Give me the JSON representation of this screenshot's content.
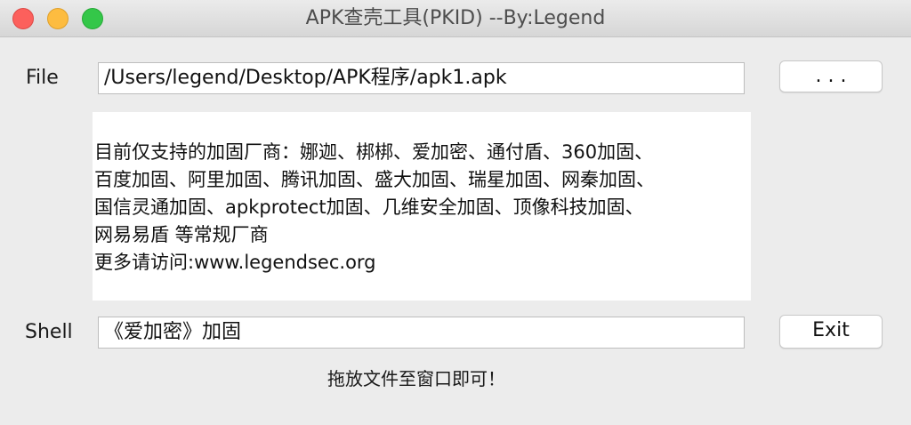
{
  "window": {
    "title": "APK查壳工具(PKID) --By:Legend"
  },
  "file_row": {
    "label": "File",
    "value": "/Users/legend/Desktop/APK程序/apk1.apk",
    "browse_label": ". . ."
  },
  "info": {
    "lines": [
      "目前仅支持的加固厂商：娜迦、梆梆、爱加密、通付盾、360加固、",
      "百度加固、阿里加固、腾讯加固、盛大加固、瑞星加固、网秦加固、",
      "国信灵通加固、apkprotect加固、几维安全加固、顶像科技加固、",
      "网易易盾 等常规厂商",
      "更多请访问:www.legendsec.org"
    ]
  },
  "shell_row": {
    "label": "Shell",
    "value": "《爱加密》加固",
    "exit_label": "Exit"
  },
  "hint": "拖放文件至窗口即可！"
}
